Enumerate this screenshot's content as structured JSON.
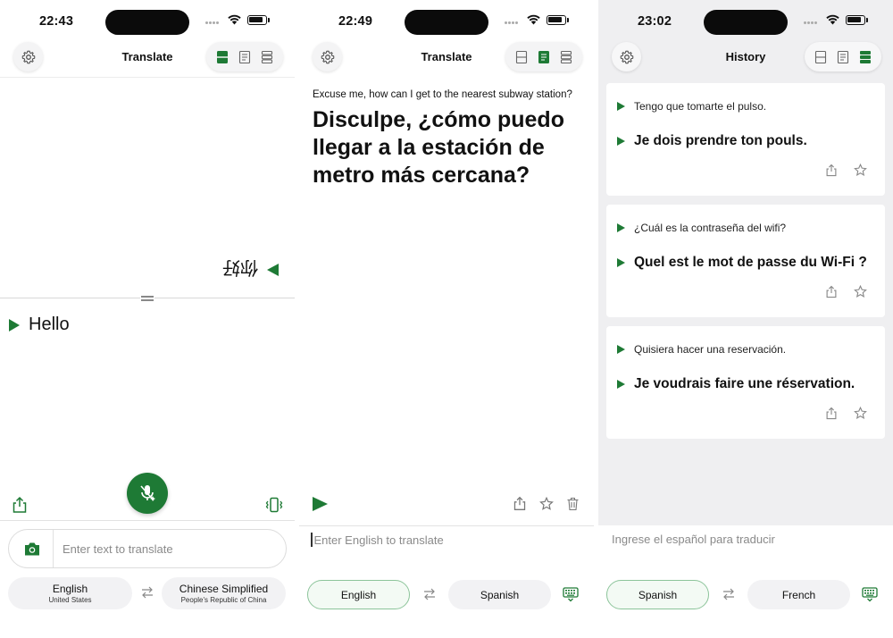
{
  "panel1": {
    "status_time": "22:43",
    "nav_title": "Translate",
    "output_text": "你好",
    "input_text": "Hello",
    "text_placeholder": "Enter text to translate",
    "source_lang": "English",
    "source_region": "United States",
    "target_lang": "Chinese Simplified",
    "target_region": "People's Republic of China",
    "icons": [
      "gear-icon",
      "layout-split-icon",
      "layout-page-icon",
      "layout-list-icon",
      "share-icon",
      "mic-icon",
      "vibrate-icon",
      "camera-icon",
      "swap-icon"
    ]
  },
  "panel2": {
    "status_time": "22:49",
    "nav_title": "Translate",
    "source_text": "Excuse me, how can I get to the nearest subway station?",
    "translated_text": "Disculpe, ¿cómo puedo llegar a la estación de metro más cercana?",
    "text_placeholder": "Enter English to translate",
    "source_lang": "English",
    "target_lang": "Spanish",
    "icons": [
      "play-icon",
      "share-icon",
      "star-icon",
      "trash-icon",
      "keyboard-icon"
    ]
  },
  "panel3": {
    "status_time": "23:02",
    "nav_title": "History",
    "history": [
      {
        "source": "Tengo que tomarte el pulso.",
        "translation": "Je dois prendre ton pouls."
      },
      {
        "source": "¿Cuál es la contraseña del wifi?",
        "translation": "Quel est le mot de passe du Wi-Fi ?"
      },
      {
        "source": "Quisiera hacer una reservación.",
        "translation": "Je voudrais faire une réservation."
      }
    ],
    "text_placeholder": "Ingrese el español para traducir",
    "source_lang": "Spanish",
    "target_lang": "French"
  },
  "colors": {
    "accent": "#1e7a35",
    "selected_pill_border": "#8cc49a",
    "history_bg": "#efeff1"
  }
}
